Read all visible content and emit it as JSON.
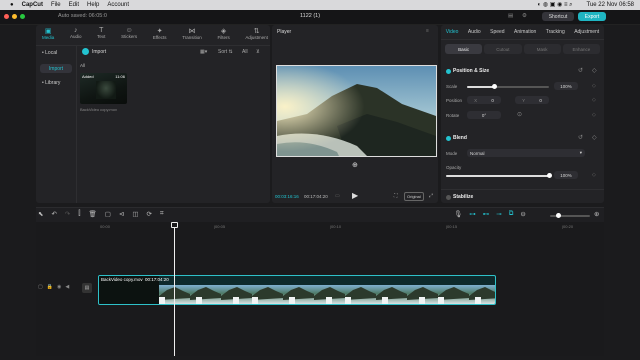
{
  "macmenu": {
    "app": "CapCut",
    "items": [
      "File",
      "Edit",
      "Help",
      "Account"
    ],
    "datetime": "Tue 22 Nov  06:58"
  },
  "titlebar": {
    "autosave": "Auto saved: 06:05:0",
    "project": "1122 (1)",
    "shortcut_label": "Shortcut",
    "export_label": "Export"
  },
  "media_tabs": [
    "Media",
    "Audio",
    "Text",
    "Stickers",
    "Effects",
    "Transition",
    "Filters",
    "Adjustment"
  ],
  "media_side": [
    "• Local",
    "Import",
    "• Library"
  ],
  "media_toolbar": {
    "import_label": "Import",
    "sort_label": "Sort",
    "all_label": "All"
  },
  "media_filter_label": "All",
  "media_clip": {
    "badge": "Added",
    "duration": "11:06",
    "name": "BackVideo copy.mov"
  },
  "player": {
    "title": "Player",
    "timecode_current": "00:03:16:16",
    "timecode_total": "00:17:04:20",
    "ratio_label": "Original"
  },
  "inspector": {
    "tabs": [
      "Video",
      "Audio",
      "Speed",
      "Animation",
      "Tracking",
      "Adjustment"
    ],
    "subtabs": [
      "Basic",
      "Cutout",
      "Mask",
      "Enhance"
    ],
    "section_position": "Position & Size",
    "scale_label": "Scale",
    "scale_value": "100%",
    "scale_level": 0.33,
    "position_label": "Position",
    "pos_x_label": "X",
    "pos_x": "0",
    "pos_y_label": "Y",
    "pos_y": "0",
    "rotate_label": "Rotate",
    "rotate_value": "0°",
    "section_blend": "Blend",
    "mode_label": "Mode",
    "mode_value": "Normal",
    "opacity_label": "Opacity",
    "opacity_value": "100%",
    "opacity_level": 1.0,
    "section_stabilize": "Stabilize"
  },
  "timeline": {
    "ruler": [
      "00:00",
      "|00:05",
      "|00:10",
      "|00:15",
      "|00:20"
    ],
    "clip_name": "BackVideo copy.mov",
    "clip_duration": "00:17:04:20"
  },
  "colors": {
    "accent": "#23c3d0",
    "export": "#1fb5c2",
    "clip_border": "#2ec1c9"
  }
}
